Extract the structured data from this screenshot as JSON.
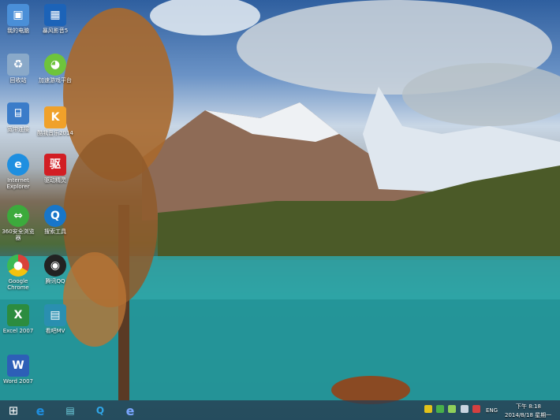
{
  "desktop_icons": [
    {
      "label": "我的电脑",
      "icon": "computer-icon",
      "color": "#4a8fd8"
    },
    {
      "label": "暴风影音5",
      "icon": "video-player-icon",
      "color": "#1c63b8"
    },
    {
      "label": "回收站",
      "icon": "recycle-bin-icon",
      "color": "#8aa9c9"
    },
    {
      "label": "加速游戏平台",
      "icon": "game-icon",
      "color": "#6ec43c"
    },
    {
      "label": "宽带连接",
      "icon": "network-icon",
      "color": "#3b7cc9"
    },
    {
      "label": "酷我音乐2014",
      "icon": "music-icon",
      "color": "#f0a12a"
    },
    {
      "label": "Internet Explorer",
      "icon": "ie-icon",
      "color": "#1f8fe0"
    },
    {
      "label": "驱动精灵",
      "icon": "driver-icon",
      "color": "#d21e24"
    },
    {
      "label": "360安全浏览器",
      "icon": "browser-360-icon",
      "color": "#3caa3c"
    },
    {
      "label": "搜索工具",
      "icon": "search-tool-icon",
      "color": "#1876c9"
    },
    {
      "label": "Google Chrome",
      "icon": "chrome-icon",
      "color": "#d9423a"
    },
    {
      "label": "腾讯QQ",
      "icon": "qq-icon",
      "color": "#222222"
    },
    {
      "label": "Excel 2007",
      "icon": "excel-icon",
      "color": "#2c8c3f"
    },
    {
      "label": "看吧MV",
      "icon": "mv-icon",
      "color": "#2a8fb0"
    },
    {
      "label": "Word 2007",
      "icon": "word-icon",
      "color": "#2d5fb7"
    }
  ],
  "taskbar": {
    "start_glyph": "⊞",
    "pinned": [
      {
        "name": "ie-icon",
        "glyph": "e"
      },
      {
        "name": "mv-icon",
        "glyph": "▤"
      },
      {
        "name": "search-tool-icon",
        "glyph": "Q"
      },
      {
        "name": "ie-blue-icon",
        "glyph": "e"
      }
    ],
    "language": "ENG",
    "time": "下午 8:18",
    "date": "2014/8/18 星期一"
  }
}
